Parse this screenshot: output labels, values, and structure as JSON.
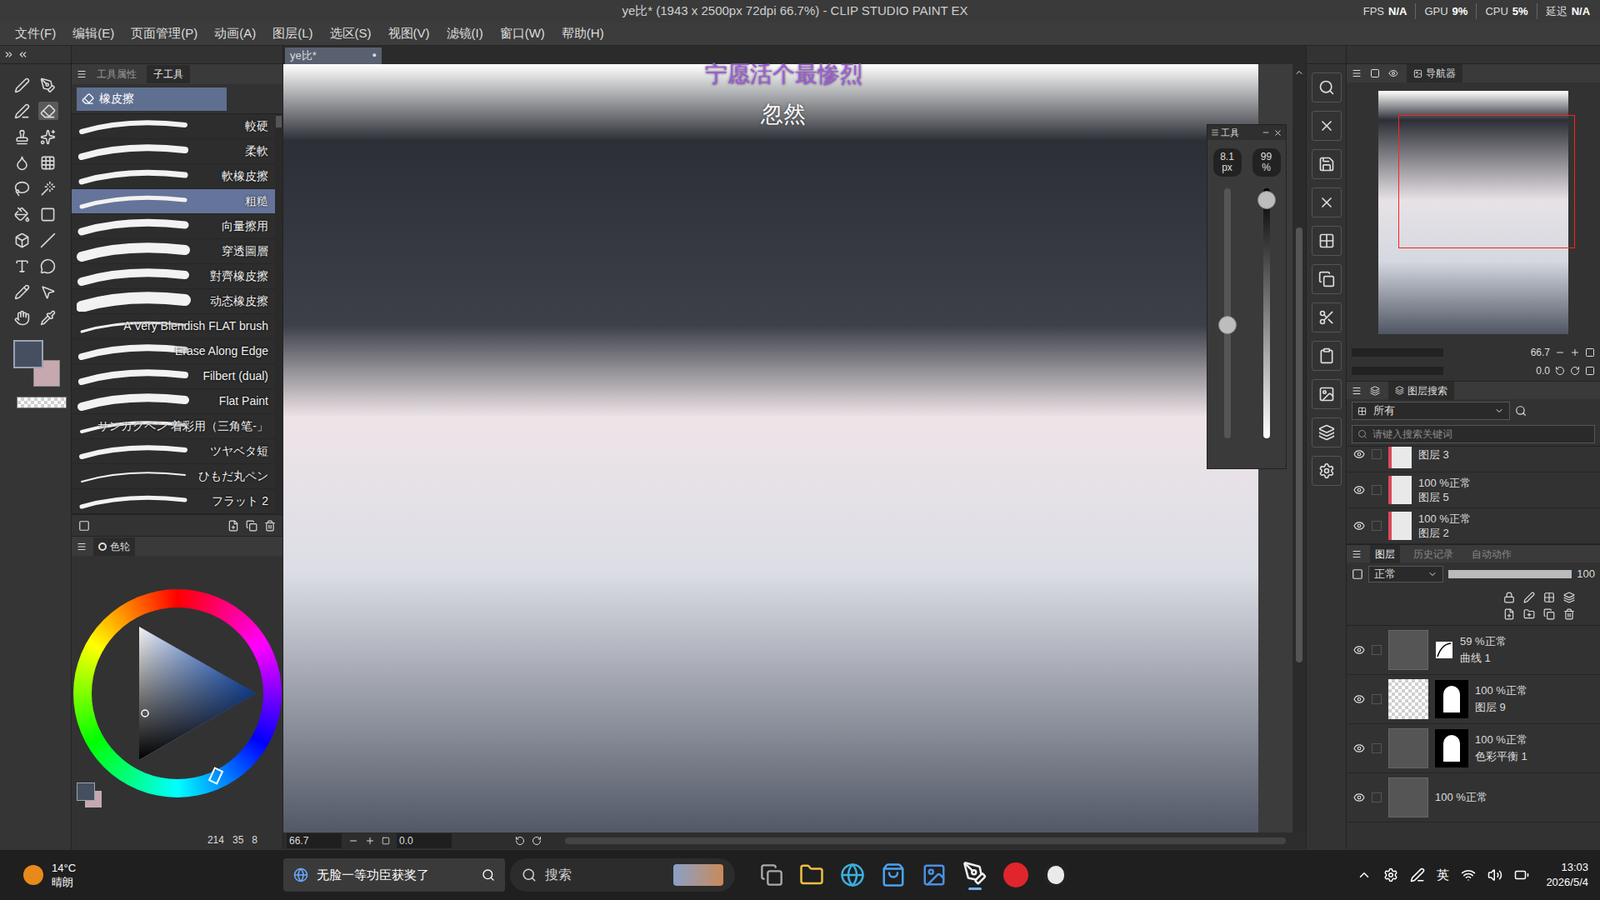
{
  "window": {
    "title": "ye比* (1943 x 2500px 72dpi 66.7%) - CLIP STUDIO PAINT EX"
  },
  "stats": [
    {
      "label": "FPS",
      "value": "N/A"
    },
    {
      "label": "GPU",
      "value": "9%"
    },
    {
      "label": "CPU",
      "value": "5%"
    },
    {
      "label": "延迟",
      "value": "N/A"
    }
  ],
  "menu": [
    "文件(F)",
    "编辑(E)",
    "页面管理(P)",
    "动画(A)",
    "图层(L)",
    "选区(S)",
    "视图(V)",
    "滤镜(I)",
    "窗口(W)",
    "帮助(H)"
  ],
  "document_tab": {
    "label": "ye比*",
    "mark": "●"
  },
  "subtool_panel": {
    "tabs": [
      {
        "label": "工具属性",
        "selected": false
      },
      {
        "label": "子工具",
        "selected": true
      }
    ],
    "group": "橡皮擦",
    "items": [
      {
        "label": "較硬",
        "selected": false
      },
      {
        "label": "柔軟",
        "selected": false
      },
      {
        "label": "軟橡皮擦",
        "selected": false
      },
      {
        "label": "粗糙",
        "selected": true
      },
      {
        "label": "向量擦用",
        "selected": false
      },
      {
        "label": "穿透圖層",
        "selected": false
      },
      {
        "label": "對齊橡皮擦",
        "selected": false
      },
      {
        "label": "动态橡皮擦",
        "selected": false
      },
      {
        "label": "A Very Blendish FLAT brush",
        "selected": false
      },
      {
        "label": "Erase Along Edge",
        "selected": false
      },
      {
        "label": "Filbert (dual)",
        "selected": false
      },
      {
        "label": "Flat Paint",
        "selected": false
      },
      {
        "label": "サンカクペン 着彩用（三角笔-」",
        "selected": false
      },
      {
        "label": "ツヤベタ短",
        "selected": false
      },
      {
        "label": "ひもだ丸ペン",
        "selected": false
      },
      {
        "label": "フラット 2",
        "selected": false
      }
    ]
  },
  "color_panel": {
    "tab": "色轮",
    "values": [
      "214",
      "35",
      "8"
    ]
  },
  "canvas": {
    "zoom": "66.7",
    "angle": "0.0"
  },
  "lyrics": [
    {
      "text": "宁愿活个最惨烈",
      "color": "#a259e0"
    },
    {
      "text": "忽然",
      "color": "#ffffff"
    }
  ],
  "tool_window": {
    "title": "工具",
    "size": {
      "value": "8.1",
      "unit": "px",
      "level": 0.45
    },
    "opacity": {
      "value": "99",
      "unit": "%",
      "level": 0.99
    }
  },
  "navigator": {
    "title": "导航器",
    "zoom": "66.7",
    "angle": "0.0"
  },
  "layer_search": {
    "title": "图层搜索",
    "filter": "所有",
    "placeholder": "请键入搜索关键词",
    "rows": [
      {
        "mode": "",
        "name": "图层 3",
        "visible": true
      },
      {
        "mode": "100 %正常",
        "name": "图层 5",
        "visible": true
      },
      {
        "mode": "100 %正常",
        "name": "图层 2",
        "visible": true
      }
    ]
  },
  "layers_panel": {
    "tabs": [
      {
        "label": "图层",
        "selected": true
      },
      {
        "label": "历史记录",
        "selected": false
      },
      {
        "label": "自动动作",
        "selected": false
      }
    ],
    "blend": "正常",
    "opacity": "100",
    "opacity_level": 1,
    "layers": [
      {
        "mode": "59 %正常",
        "name": "曲线 1",
        "kind": "curve",
        "visible": true
      },
      {
        "mode": "100 %正常",
        "name": "图层 9",
        "kind": "masked",
        "visible": true
      },
      {
        "mode": "100 %正常",
        "name": "色彩平衡 1",
        "kind": "balance",
        "visible": true
      },
      {
        "mode": "100 %正常",
        "name": "",
        "kind": "raster",
        "visible": true
      }
    ]
  },
  "taskbar": {
    "weather": {
      "temp": "14°C",
      "desc": "晴朗"
    },
    "news": "无脸一等功臣获奖了",
    "search": "搜索",
    "ime": "英",
    "time": "13:03",
    "date": "2026/5/4"
  }
}
